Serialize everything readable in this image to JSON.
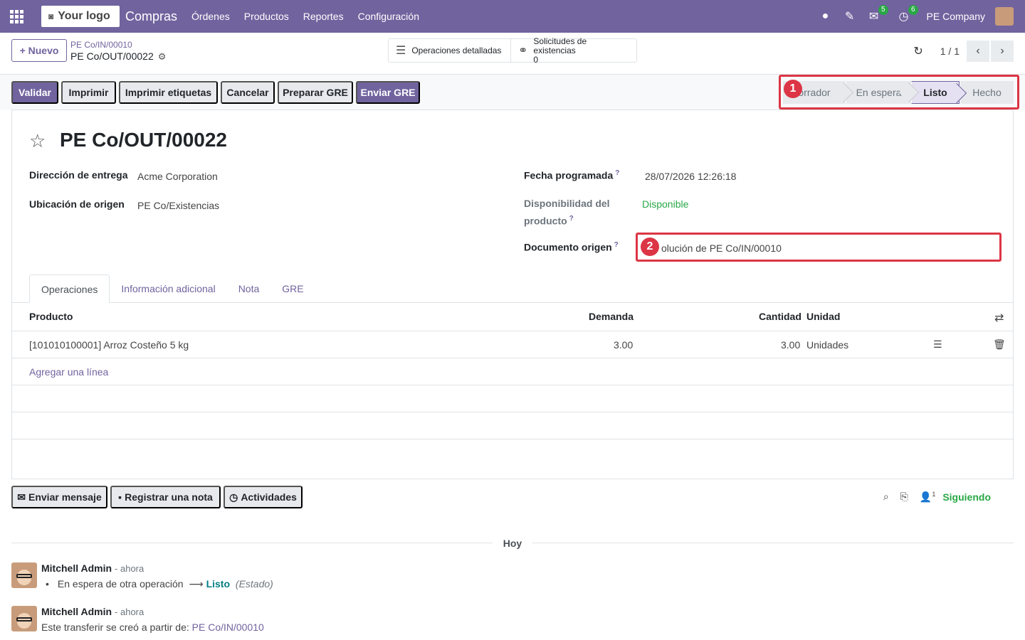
{
  "navbar": {
    "logo": "Your logo",
    "app_name": "Compras",
    "menu": [
      "Órdenes",
      "Productos",
      "Reportes",
      "Configuración"
    ],
    "messages_badge": "5",
    "activities_badge": "6",
    "company": "PE Company"
  },
  "control": {
    "new_label": "+ Nuevo",
    "breadcrumb_parent": "PE Co/IN/00010",
    "breadcrumb_current": "PE Co/OUT/00022",
    "smart_detailed": "Operaciones detalladas",
    "smart_requests_label": "Solicitudes de existencias",
    "smart_requests_count": "0",
    "pager": "1 / 1"
  },
  "actions": {
    "validate": "Validar",
    "print": "Imprimir",
    "print_labels": "Imprimir etiquetas",
    "cancel": "Cancelar",
    "prepare_gre": "Preparar GRE",
    "send_gre": "Enviar GRE"
  },
  "stages": [
    "orrador",
    "En espera",
    "Listo",
    "Hecho"
  ],
  "annotations": [
    "1",
    "2"
  ],
  "form": {
    "title": "PE Co/OUT/00022",
    "delivery_address_label": "Dirección de entrega",
    "delivery_address": "Acme Corporation",
    "source_location_label": "Ubicación de origen",
    "source_location": "PE Co/Existencias",
    "scheduled_date_label": "Fecha programada",
    "scheduled_date": "28/07/2026 12:26:18",
    "availability_label_1": "Disponibilidad del",
    "availability_label_2": "producto",
    "availability": "Disponible",
    "origin_label": "Documento origen",
    "origin": "olución de PE Co/IN/00010",
    "qmark": "?"
  },
  "tabs": [
    "Operaciones",
    "Información adicional",
    "Nota",
    "GRE"
  ],
  "table": {
    "headers": {
      "product": "Producto",
      "demand": "Demanda",
      "quantity": "Cantidad",
      "unit": "Unidad"
    },
    "rows": [
      {
        "product": "[101010100001] Arroz Costeño 5 kg",
        "demand": "3.00",
        "quantity": "3.00",
        "unit": "Unidades"
      }
    ],
    "add_line": "Agregar una línea"
  },
  "chatter": {
    "send_message": "Enviar mensaje",
    "log_note": "Registrar una nota",
    "activities": "Actividades",
    "followers_count": "1",
    "following": "Siguiendo",
    "today": "Hoy",
    "messages": [
      {
        "author": "Mitchell Admin",
        "time": "- ahora",
        "from": "En espera de otra operación",
        "to": "Listo",
        "field": "(Estado)"
      },
      {
        "author": "Mitchell Admin",
        "time": "- ahora",
        "text": "Este transferir se creó a partir de:",
        "link": "PE Co/IN/00010"
      }
    ]
  },
  "colors": {
    "brand": "#71639e",
    "success": "#28a745",
    "annotation": "#dc3545"
  }
}
